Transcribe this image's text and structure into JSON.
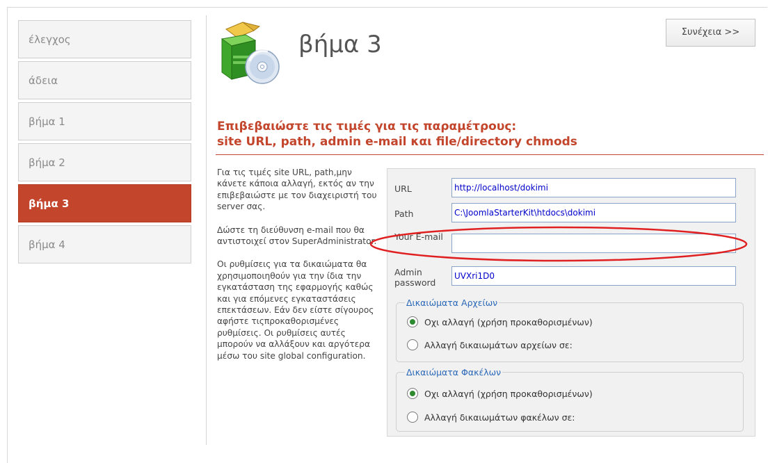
{
  "sidebar": {
    "items": [
      {
        "label": "έλεγχος",
        "active": false
      },
      {
        "label": "άδεια",
        "active": false
      },
      {
        "label": "βήμα 1",
        "active": false
      },
      {
        "label": "βήμα 2",
        "active": false
      },
      {
        "label": "βήμα 3",
        "active": true
      },
      {
        "label": "βήμα 4",
        "active": false
      }
    ]
  },
  "header": {
    "title": "βήμα 3",
    "continue_label": "Συνέχεια >>",
    "icon": "install-box-cd-icon"
  },
  "main": {
    "heading_line1": "Επιβεβαιώστε τις τιμές για τις παραμέτρους:",
    "heading_line2": "site URL, path, admin e-mail και file/directory chmods",
    "description": [
      "Για τις τιμές site URL, path,μην κάνετε κάποια αλλαγή, εκτός αν την επιβεβαιώστε με τον διαχειριστή του server σας.",
      "Δώστε τη διεύθυνση e-mail που θα αντιστοιχεί στον SuperAdministrator.",
      "Οι ρυθμίσεις για τα δικαιώματα θα χρησιμοποιηθούν για την ίδια την εγκατάσταση της εφαρμογής καθώς και για επόμενες εγκαταστάσεις επεκτάσεων. Εάν δεν είστε σίγουρος αφήστε τιςπροκαθορισμένες ρυθμίσεις. Οι ρυθμίσεις αυτές μπορούν να αλλάξουν και αργότερα μέσω του site global configuration."
    ]
  },
  "form": {
    "url_label": "URL",
    "url_value": "http://localhost/dokimi",
    "path_label": "Path",
    "path_value": "C:\\JoomlaStarterKit\\htdocs\\dokimi",
    "email_label": "Your E-mail",
    "email_value": "",
    "password_label": "Admin password",
    "password_value": "UVXri1D0",
    "file_perms": {
      "legend": "Δικαιώματα Αρχείων",
      "option_default": "Οχι αλλαγή (χρήση προκαθορισμένων)",
      "option_change": "Αλλαγή δικαιωμάτων αρχείων σε:",
      "selected": "default"
    },
    "dir_perms": {
      "legend": "Δικαιώματα Φακέλων",
      "option_default": "Οχι αλλαγή (χρήση προκαθορισμένων)",
      "option_change": "Αλλαγή δικαιωμάτων φακέλων σε:",
      "selected": "default"
    }
  },
  "colors": {
    "accent": "#c3452c",
    "legend": "#2a68b8",
    "annotation": "#e02020"
  }
}
